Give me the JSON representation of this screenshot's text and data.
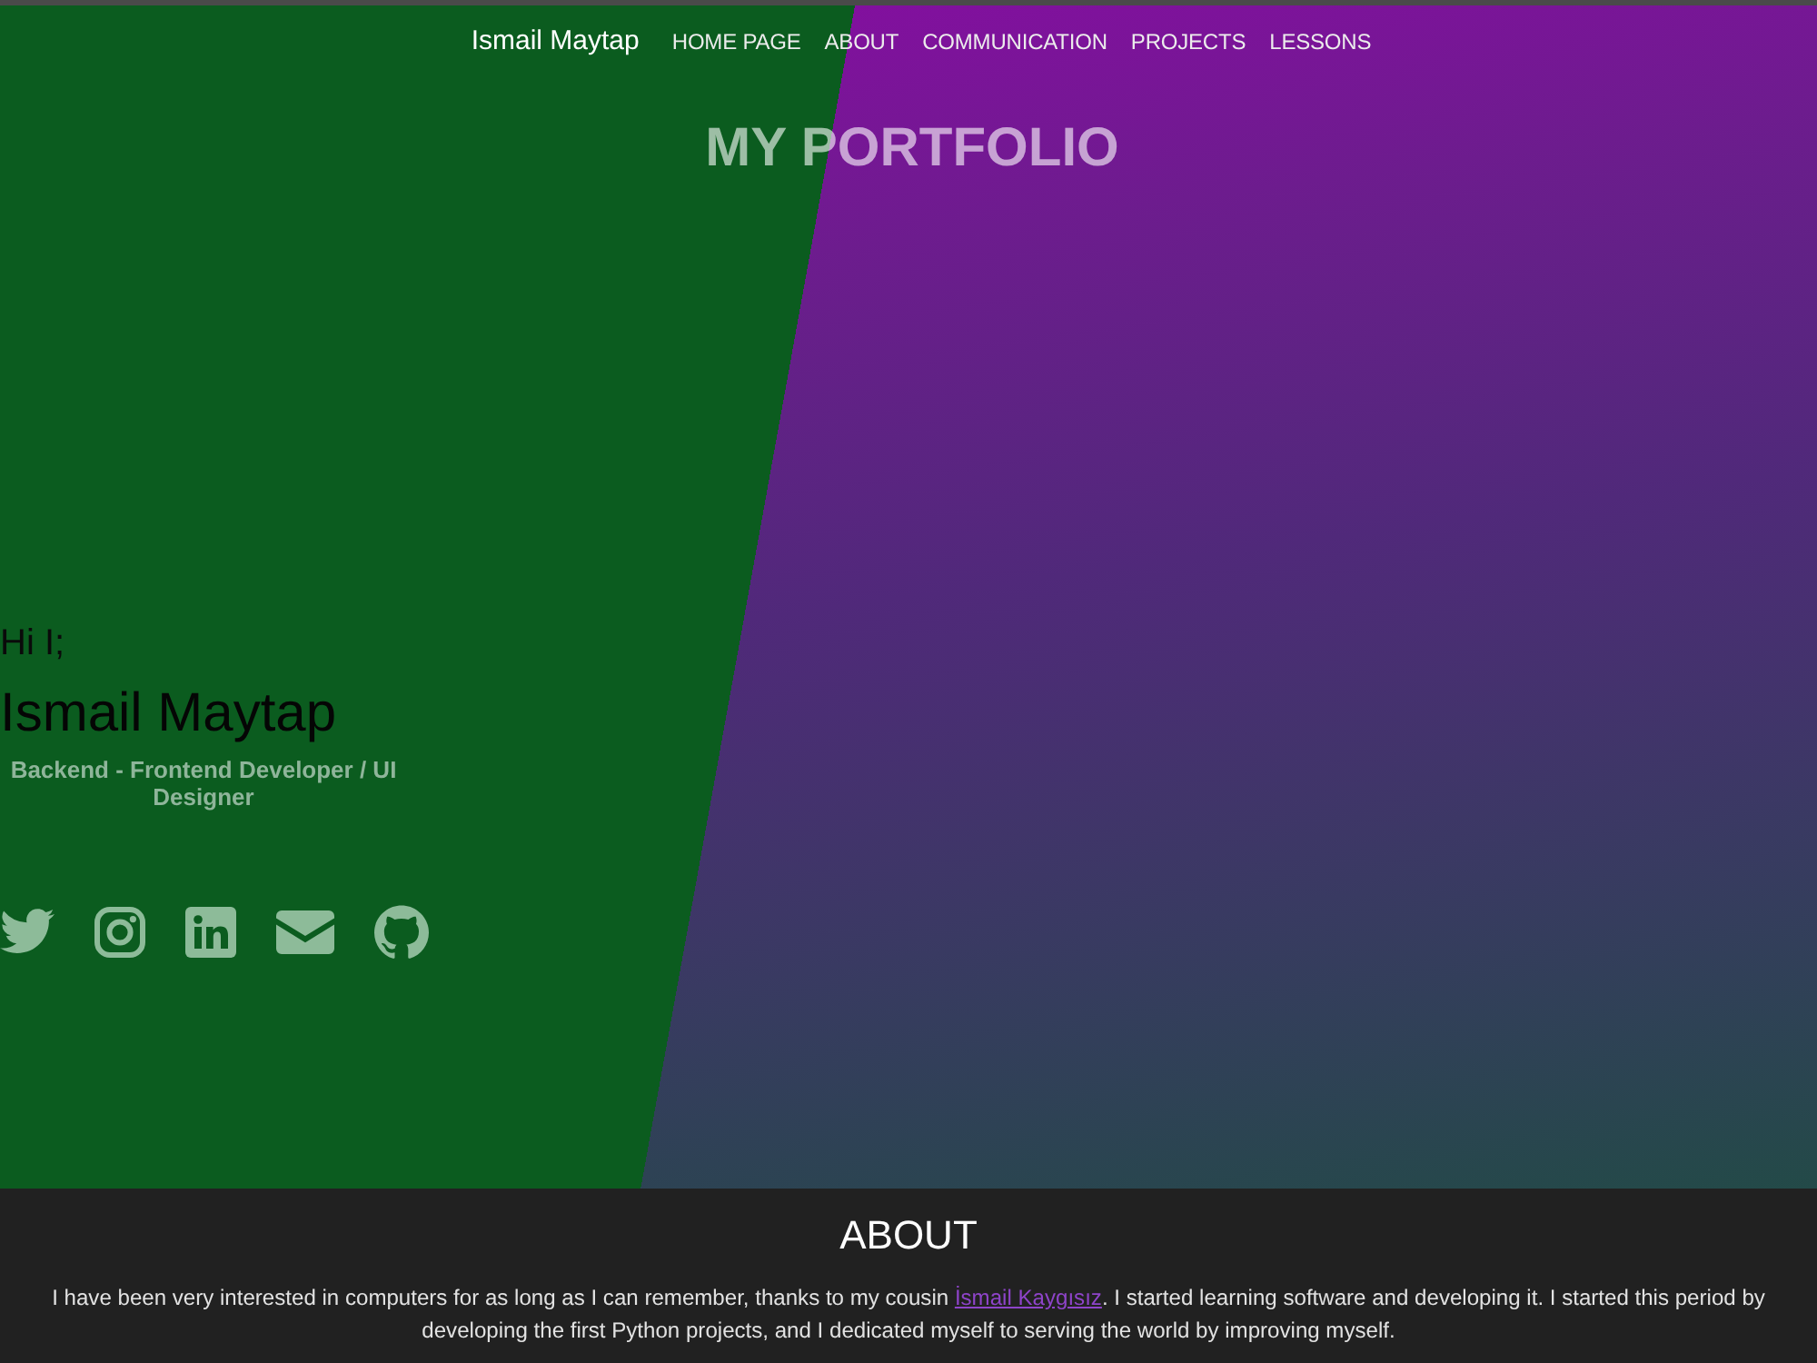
{
  "navbar": {
    "brand": "Ismail Maytap",
    "links": [
      {
        "label": "HOME PAGE"
      },
      {
        "label": "ABOUT"
      },
      {
        "label": "COMMUNICATION"
      },
      {
        "label": "PROJECTS"
      },
      {
        "label": "LESSONS"
      }
    ]
  },
  "hero": {
    "title": "MY PORTFOLIO",
    "greeting": "Hi I;",
    "name": "Ismail Maytap",
    "role": "Backend - Frontend Developer / UI Designer"
  },
  "about": {
    "heading": "ABOUT",
    "text_before": "I have been very interested in computers for as long as I can remember, thanks to my cousin ",
    "link": "İsmail Kaygısız",
    "text_after": ". I started learning software and developing it. I started this period by developing the first Python projects, and I dedicated myself to serving the world by improving myself."
  }
}
